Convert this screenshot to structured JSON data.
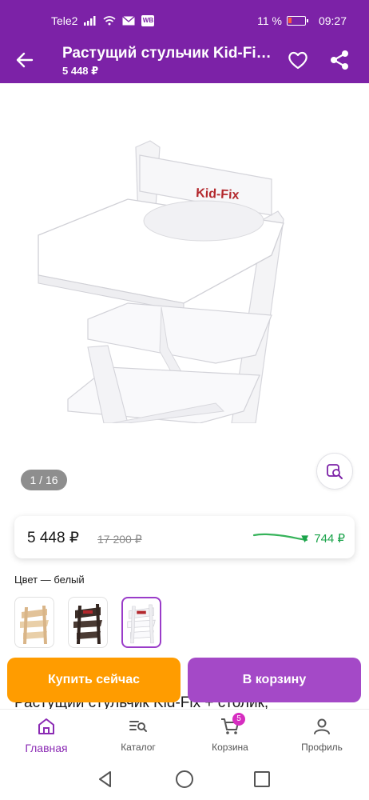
{
  "status_bar": {
    "carrier": "Tele2",
    "app_badge": "WB",
    "battery_percent": "11 %",
    "time": "09:27"
  },
  "header": {
    "title": "Растущий стульчик Kid-Fix + столик",
    "price": "5 448 ₽"
  },
  "gallery": {
    "counter": "1 / 16",
    "brand_text": "Kid-Fix"
  },
  "price_card": {
    "current": "5 448 ₽",
    "old": "17 200 ₽",
    "drop": "▼ 744 ₽"
  },
  "color": {
    "label": "Цвет — белый",
    "swatches": [
      {
        "name": "natural",
        "color": "#e9cfa8"
      },
      {
        "name": "dark",
        "color": "#4a3a33"
      },
      {
        "name": "white",
        "color": "#ffffff",
        "selected": true
      }
    ]
  },
  "product_title_partial": "Растущий стульчик Kid-Fix + столик,",
  "actions": {
    "buy_now": "Купить сейчас",
    "add_to_cart": "В корзину"
  },
  "tabbar": {
    "items": [
      {
        "label": "Главная",
        "icon": "home-icon",
        "active": true
      },
      {
        "label": "Каталог",
        "icon": "catalog-search-icon"
      },
      {
        "label": "Корзина",
        "icon": "cart-icon",
        "badge": "5"
      },
      {
        "label": "Профиль",
        "icon": "profile-icon"
      }
    ]
  },
  "colors": {
    "header_bg": "#7c22a7",
    "buy_button": "#ff9c00",
    "cart_button": "#a449c7",
    "price_drop": "#1aa34a",
    "active_tab": "#8b2bb4"
  }
}
